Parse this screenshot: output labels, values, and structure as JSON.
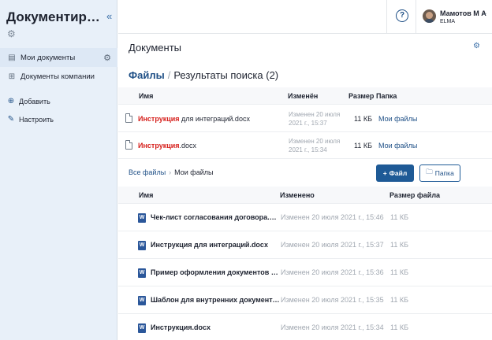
{
  "sidebar": {
    "title": "Документирова...",
    "collapse_icon": "«",
    "items": [
      {
        "label": "Мои документы",
        "icon": "folder-user-icon"
      },
      {
        "label": "Документы компании",
        "icon": "folders-icon"
      }
    ],
    "actions": [
      {
        "label": "Добавить",
        "icon": "plus-circle-icon"
      },
      {
        "label": "Настроить",
        "icon": "wrench-icon"
      }
    ]
  },
  "header": {
    "help_label": "?",
    "user_name": "Мамотов М А",
    "user_org": "ELMA"
  },
  "page": {
    "title": "Документы",
    "crumb_link": "Файлы",
    "crumb_sep": "/",
    "crumb_current": "Результаты поиска (2)"
  },
  "search": {
    "columns": {
      "name": "Имя",
      "modified": "Изменён",
      "size": "Размер",
      "folder": "Папка"
    },
    "rows": [
      {
        "highlight": "Инструкция",
        "rest": " для интеграций.docx",
        "mod_line1": "Изменен 20 июля",
        "mod_line2": "2021 г., 15:37",
        "size": "11 КБ",
        "folder": "Мои файлы"
      },
      {
        "highlight": "Инструкция",
        "rest": ".docx",
        "mod_line1": "Изменен 20 июля",
        "mod_line2": "2021 г., 15:34",
        "size": "11 КБ",
        "folder": "Мои файлы"
      }
    ]
  },
  "folder_bar": {
    "crumb_link": "Все файлы",
    "crumb_sep": "›",
    "crumb_current": "Мои файлы",
    "file_button": "Файл",
    "folder_button": "Папка"
  },
  "files": {
    "columns": {
      "name": "Имя",
      "modified": "Изменено",
      "size": "Размер файла"
    },
    "rows": [
      {
        "name": "Чек-лист согласования договора.docx",
        "modified": "Изменен 20 июля 2021 г., 15:46",
        "size": "11 КБ"
      },
      {
        "name": "Инструкция для интеграций.docx",
        "modified": "Изменен 20 июля 2021 г., 15:37",
        "size": "11 КБ"
      },
      {
        "name": "Пример оформления документов ком...",
        "modified": "Изменен 20 июля 2021 г., 15:36",
        "size": "11 КБ"
      },
      {
        "name": "Шаблон для внутренних документов.d...",
        "modified": "Изменен 20 июля 2021 г., 15:35",
        "size": "11 КБ"
      },
      {
        "name": "Инструкция.docx",
        "modified": "Изменен 20 июля 2021 г., 15:34",
        "size": "11 КБ"
      }
    ]
  }
}
